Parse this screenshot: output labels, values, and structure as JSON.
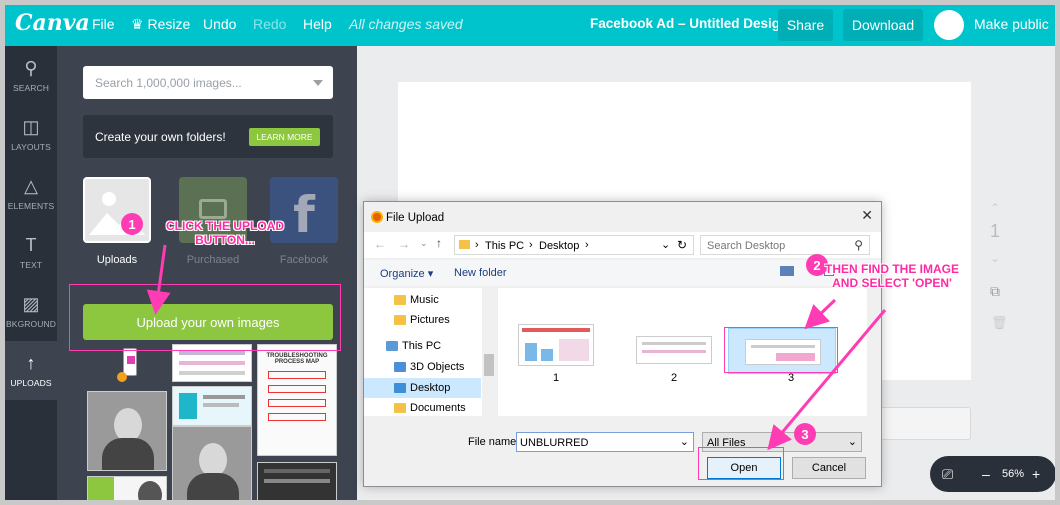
{
  "topbar": {
    "logo": "Canva",
    "menu": [
      "File",
      "Resize",
      "Undo",
      "Redo",
      "Help"
    ],
    "status": "All changes saved",
    "doc_title": "Facebook Ad – Untitled Design",
    "share": "Share",
    "download": "Download",
    "make_public": "Make public",
    "colors": {
      "bar": "#00c4cc",
      "button": "#00aeb6"
    }
  },
  "rail": [
    {
      "label": "SEARCH",
      "icon": "search-icon"
    },
    {
      "label": "LAYOUTS",
      "icon": "layouts-icon"
    },
    {
      "label": "ELEMENTS",
      "icon": "elements-icon"
    },
    {
      "label": "TEXT",
      "icon": "text-icon"
    },
    {
      "label": "BKGROUND",
      "icon": "background-icon"
    },
    {
      "label": "UPLOADS",
      "icon": "upload-icon"
    }
  ],
  "panel": {
    "search_placeholder": "Search 1,000,000 images...",
    "folders_text": "Create your own folders!",
    "learn_more": "LEARN MORE",
    "sources": [
      "Uploads",
      "Purchased",
      "Facebook"
    ],
    "upload_button": "Upload your own images",
    "thumb_text": "TROUBLESHOOTING PROCESS MAP"
  },
  "canvas": {
    "page_number": "1",
    "zoom": "56%",
    "zoom_minus": "–",
    "zoom_plus": "+"
  },
  "dialog": {
    "title": "File Upload",
    "path": [
      "This PC",
      "Desktop"
    ],
    "search_placeholder": "Search Desktop",
    "organize": "Organize",
    "new_folder": "New folder",
    "tree": [
      "Music",
      "Pictures",
      "This PC",
      "3D Objects",
      "Desktop",
      "Documents"
    ],
    "files": [
      "1",
      "2",
      "3"
    ],
    "file_name_label": "File name:",
    "file_name_value": "UNBLURRED",
    "file_type": "All Files",
    "open": "Open",
    "cancel": "Cancel"
  },
  "annotations": {
    "step1_num": "1",
    "step1_text": "CLICK THE UPLOAD BUTTON...",
    "step2_num": "2",
    "step2_text": "THEN FIND THE IMAGE AND SELECT 'OPEN'",
    "step3_num": "3",
    "color": "#ff3cb4"
  }
}
